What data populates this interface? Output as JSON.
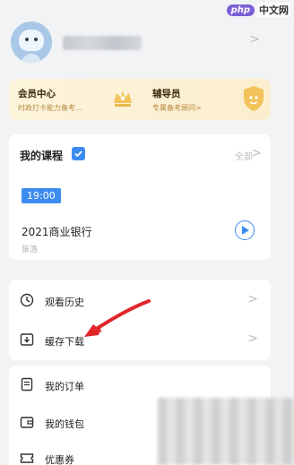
{
  "watermark": {
    "logo": "php",
    "text": "中文网"
  },
  "profile": {
    "avatar": "avatar-icon",
    "chevron": "chevron-right-icon"
  },
  "member_center": {
    "left": {
      "title": "会员中心",
      "subtitle": "时政打卡能力备考...",
      "icon": "crown-icon"
    },
    "right": {
      "title": "辅导员",
      "subtitle": "专属备考顾问>",
      "icon": "shield-icon"
    }
  },
  "courses": {
    "title": "我的课程",
    "all_label": "全部",
    "time_tag": "19:00",
    "course_name": "2021商业银行",
    "course_sub": "张浩"
  },
  "menu_group1": [
    {
      "label": "观看历史",
      "icon": "clock-icon"
    },
    {
      "label": "缓存下载",
      "icon": "download-icon"
    }
  ],
  "menu_group2": [
    {
      "label": "我的订单",
      "icon": "order-icon"
    },
    {
      "label": "我的钱包",
      "icon": "wallet-icon"
    },
    {
      "label": "优惠券",
      "icon": "coupon-icon"
    }
  ],
  "colors": {
    "accent": "#3c8cf0",
    "gold_bg": "#fdf4dd",
    "arrow": "#e0262b"
  }
}
